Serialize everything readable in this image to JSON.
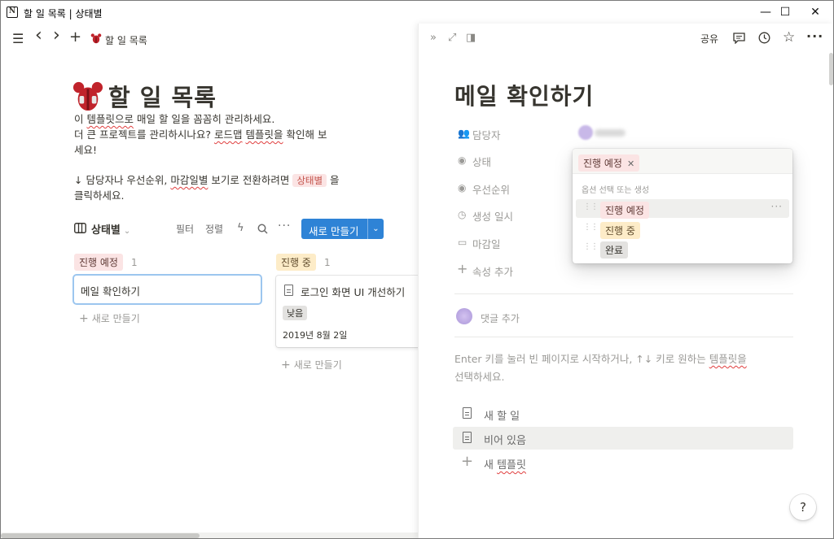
{
  "window": {
    "title": "할 일 목록 | 상태별",
    "app_icon": "N",
    "minimize": "—",
    "maximize": "☐",
    "close": "✕"
  },
  "topbar": {
    "menu_icon": "☰",
    "back_icon": "‹",
    "forward_icon": "›",
    "add_icon": "+",
    "breadcrumb": "할 일 목록"
  },
  "page": {
    "title": "할 일 목록",
    "desc_line1_pre": "이 ",
    "desc_line1_link": "템플릿으로",
    "desc_line1_post": " 매일 할 일을 꼼꼼히 관리하세요.",
    "desc_line2_pre": "더 큰 프로젝트를 관리하시나요? ",
    "desc_line2_link": "로드맵",
    "desc_line2_space": " ",
    "desc_line2_link2": "템플릿을",
    "desc_line2_post": " 확인해 보",
    "desc_line3": "세요!",
    "desc_line4_pre": "↓ 담당자나 우선순위, ",
    "desc_line4_link": "마감일별",
    "desc_line4_post": " 보기로 전환하려면 ",
    "desc_line4_pill": "상태별",
    "desc_line4_end": " 을",
    "desc_line5": "클릭하세요."
  },
  "db_toolbar": {
    "view_label": "상태별",
    "filter": "필터",
    "sort": "정렬",
    "new_button": "새로 만들기"
  },
  "board": {
    "columns": [
      {
        "name": "진행 예정",
        "count": "1",
        "cards": [
          {
            "title": "메일 확인하기"
          }
        ],
        "add_label": "새로 만들기"
      },
      {
        "name": "진행 중",
        "count": "1",
        "cards": [
          {
            "title": "로그인 화면 UI 개선하기",
            "priority": "낮음",
            "date": "2019년 8월 2일"
          }
        ],
        "add_label": "새로 만들기"
      }
    ]
  },
  "peek": {
    "share": "공유",
    "title": "메일 확인하기",
    "properties": [
      {
        "label": "담당자",
        "icon": "people-icon"
      },
      {
        "label": "상태",
        "icon": "status-icon"
      },
      {
        "label": "우선순위",
        "icon": "priority-icon"
      },
      {
        "label": "생성 일시",
        "icon": "clock-icon"
      },
      {
        "label": "마감일",
        "icon": "calendar-icon"
      }
    ],
    "add_property": "속성 추가",
    "comment_placeholder": "댓글 추가",
    "hint_pre": "Enter 키를 눌러 빈 페이지로 시작하거나, ↑↓ 키로 원하는 ",
    "hint_link": "템플릿을",
    "hint_post": "선택하세요.",
    "templates": [
      {
        "label": "새 할 일"
      },
      {
        "label": "비어 있음"
      }
    ],
    "new_template_pre": "새 ",
    "new_template_link": "템플릿",
    "help": "?"
  },
  "status_dropdown": {
    "selected": "진행 예정",
    "remove_icon": "✕",
    "header": "옵션 선택 또는 생성",
    "options": [
      {
        "label": "진행 예정",
        "color": "red"
      },
      {
        "label": "진행 중",
        "color": "yellow"
      },
      {
        "label": "완료",
        "color": "gray"
      }
    ]
  },
  "colors": {
    "accent": "#2e83d6",
    "tag_red": "#fbe4e4",
    "tag_yellow": "#fdecc8",
    "tag_gray": "#e3e2e0"
  }
}
